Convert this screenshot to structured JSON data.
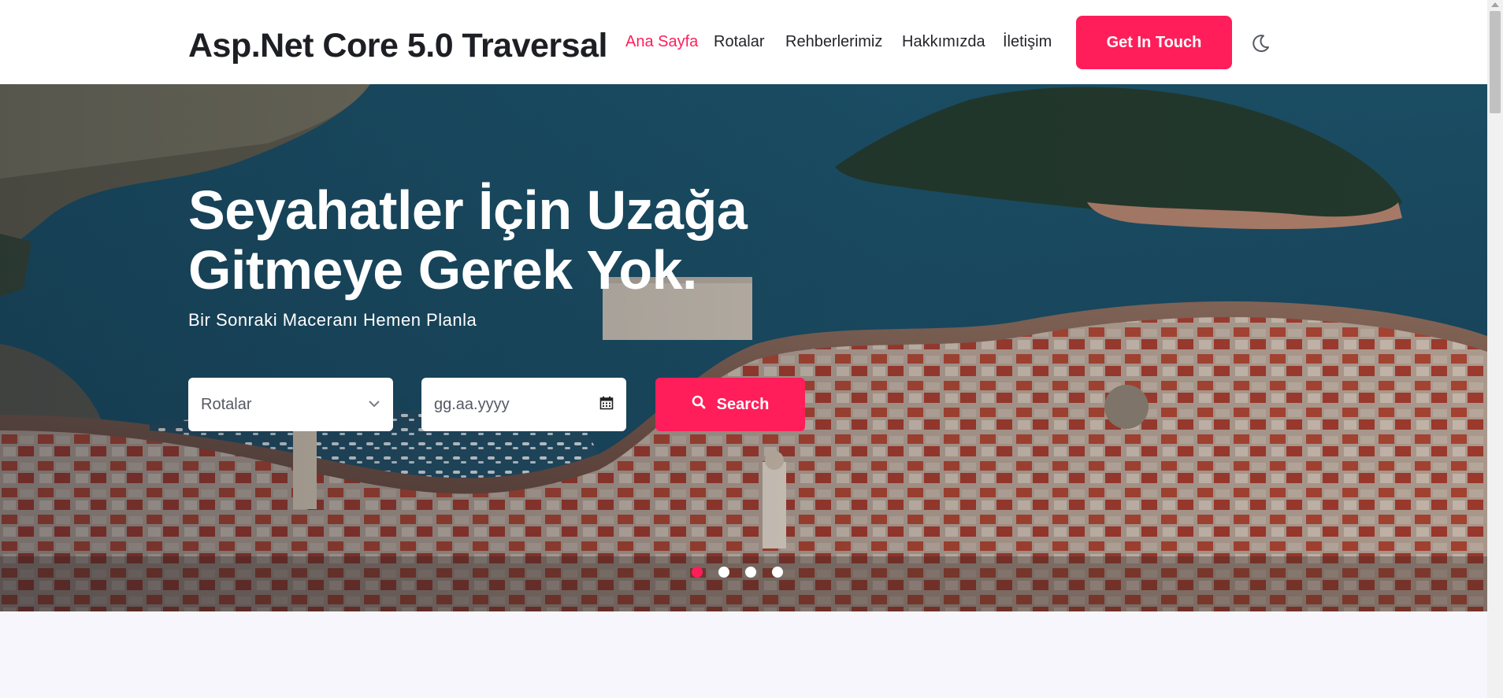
{
  "header": {
    "brand": "Asp.Net Core 5.0 Traversal",
    "nav": [
      {
        "label": "Ana Sayfa",
        "active": true
      },
      {
        "label": "Rotalar",
        "active": false
      },
      {
        "label": "Rehberlerimiz",
        "active": false
      },
      {
        "label": "Hakkımızda",
        "active": false
      },
      {
        "label": "İletişim",
        "active": false
      }
    ],
    "cta_label": "Get In Touch",
    "theme_icon": "moon-icon"
  },
  "hero": {
    "title_line1": "Seyahatler İçin Uzağa",
    "title_line2": "Gitmeye Gerek Yok.",
    "subtitle": "Bir Sonraki Maceranı Hemen Planla",
    "route_select": {
      "value": "Rotalar",
      "icon": "chevron-down-icon"
    },
    "date_input": {
      "placeholder": "gg.aa.yyyy",
      "icon": "calendar-icon"
    },
    "search_label": "Search",
    "search_icon": "search-icon",
    "slides": {
      "count": 4,
      "active_index": 0
    }
  },
  "colors": {
    "accent": "#ff1e5a",
    "text_dark": "#1e1f24",
    "page_bg": "#f7f6fd",
    "white": "#ffffff"
  }
}
